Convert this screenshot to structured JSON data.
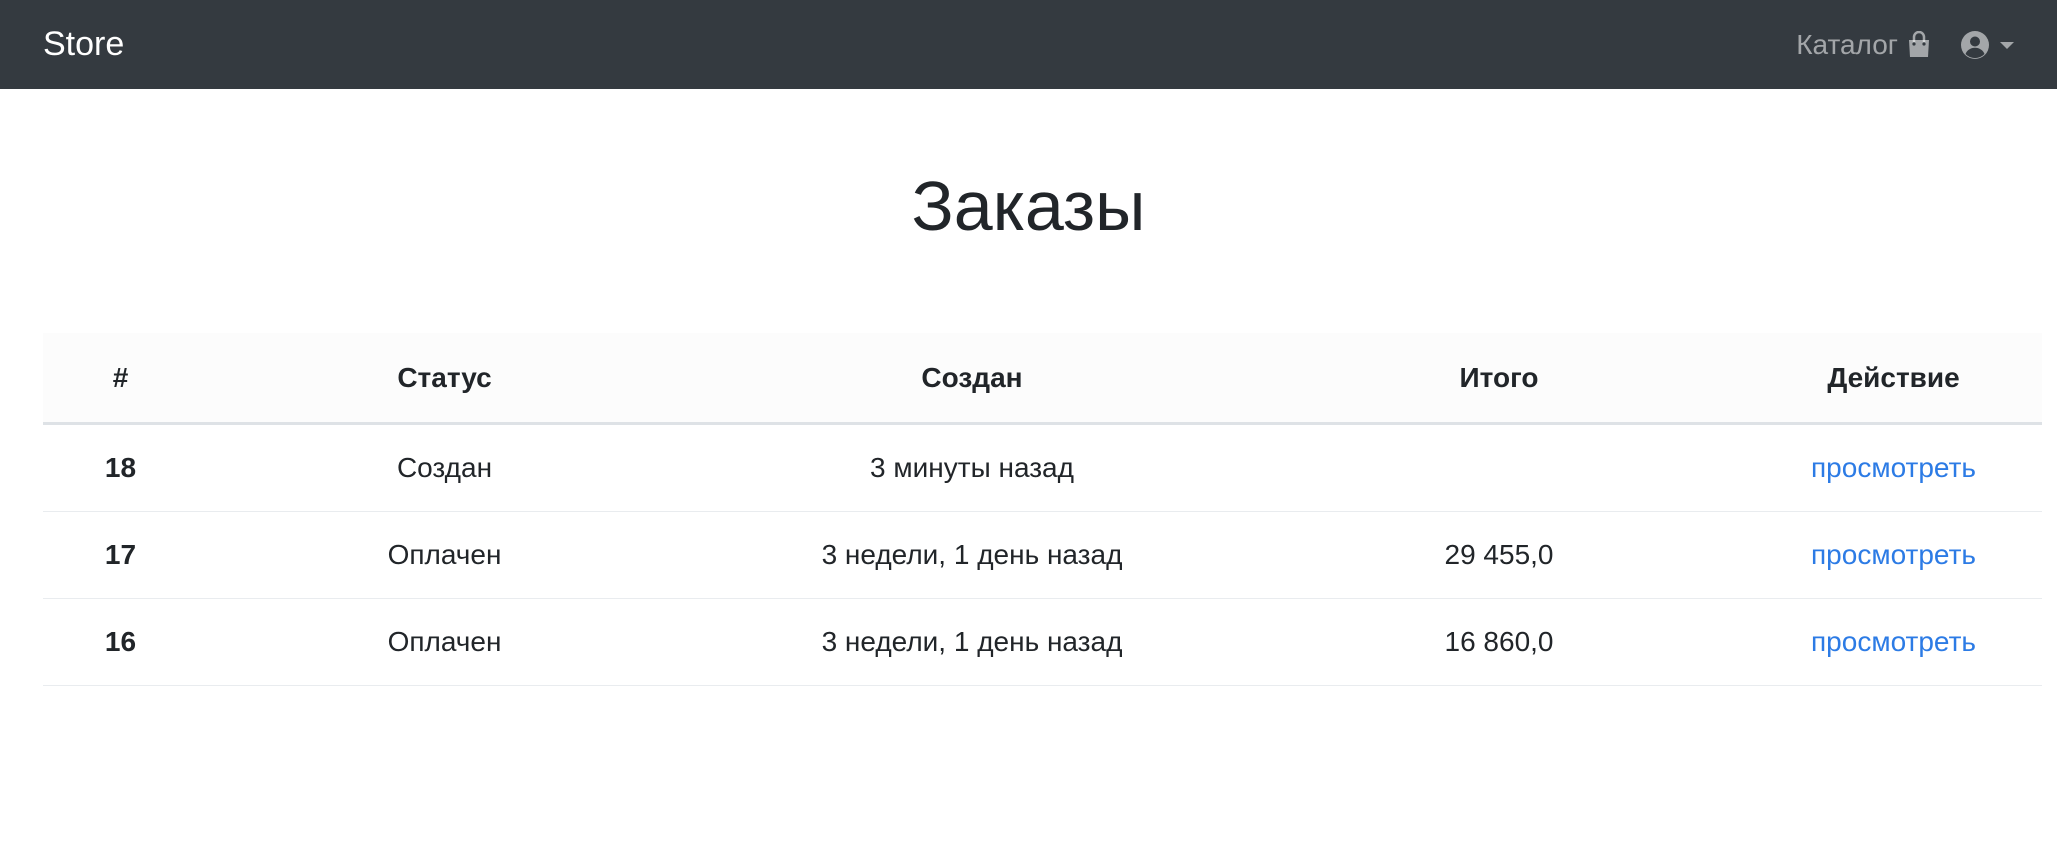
{
  "navbar": {
    "brand": "Store",
    "catalog_label": "Каталог",
    "catalog_icon": "shopping-bag-icon",
    "user_icon": "user-circle-icon",
    "dropdown_icon": "caret-down-icon",
    "bg_color": "#343a40"
  },
  "page": {
    "title": "Заказы"
  },
  "orders_table": {
    "headers": [
      "#",
      "Статус",
      "Создан",
      "Итого",
      "Действие"
    ],
    "rows": [
      {
        "id": "18",
        "status": "Создан",
        "created": "3 минуты назад",
        "total": "",
        "action": "просмотреть"
      },
      {
        "id": "17",
        "status": "Оплачен",
        "created": "3 недели, 1 день назад",
        "total": "29 455,0",
        "action": "просмотреть"
      },
      {
        "id": "16",
        "status": "Оплачен",
        "created": "3 недели, 1 день назад",
        "total": "16 860,0",
        "action": "просмотреть"
      }
    ],
    "link_color": "#2c7be5"
  }
}
